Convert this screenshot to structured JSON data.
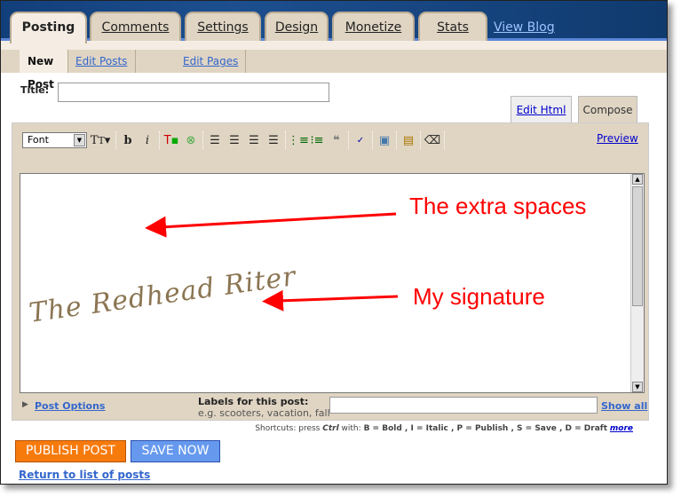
{
  "tabs": [
    {
      "label": "Posting"
    },
    {
      "label": "Comments"
    },
    {
      "label": "Settings"
    },
    {
      "label": "Design"
    },
    {
      "label": "Monetize"
    },
    {
      "label": "Stats"
    }
  ],
  "view_blog": "View Blog",
  "subnav": [
    {
      "label": "New Post"
    },
    {
      "label": "Edit Posts"
    },
    {
      "label": "Edit Pages"
    }
  ],
  "title_label": "Title:",
  "title_value": "",
  "mode_tabs": {
    "edit_html": "Edit Html",
    "compose": "Compose"
  },
  "toolbar": {
    "font": "Font",
    "preview": "Preview"
  },
  "signature": "The Redhead Riter",
  "annotations": {
    "extra_spaces": "The extra spaces",
    "signature": "My signature"
  },
  "post_options": "Post Options",
  "labels": {
    "title": "Labels for this post:",
    "example": "e.g. scooters, vacation, fall",
    "value": "",
    "show_all": "Show all"
  },
  "shortcuts": {
    "prefix": "Shortcuts: press",
    "ctrl": "Ctrl",
    "with": "with:",
    "items": "B = Bold , I = Italic , P = Publish , S = Save , D = Draft",
    "more": "more"
  },
  "buttons": {
    "publish": "PUBLISH POST",
    "save": "SAVE NOW"
  },
  "return_link": "Return to list of posts",
  "colors": {
    "publish": "#f77a0c",
    "save": "#6699ee",
    "annotation": "#ff0000",
    "panel": "#e0d5c3"
  }
}
